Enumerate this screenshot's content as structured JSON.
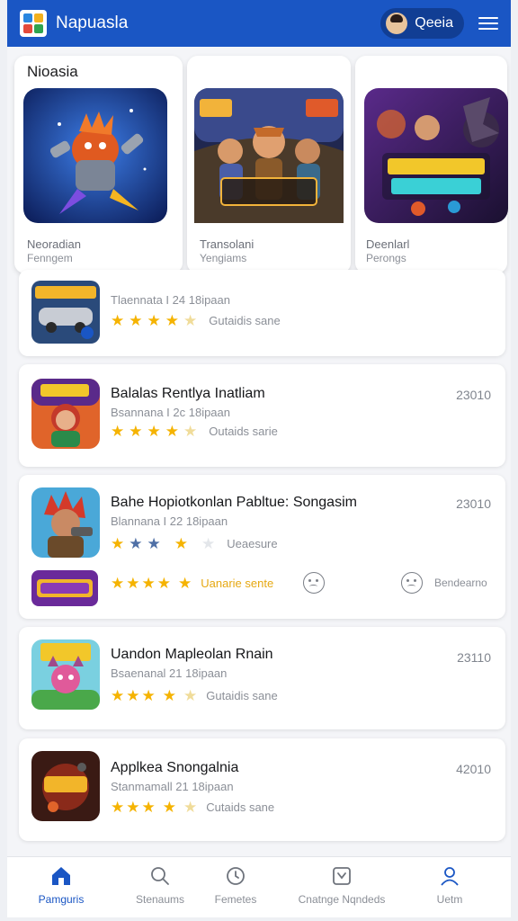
{
  "header": {
    "app_title": "Napuasla",
    "user_name": "Qeeia",
    "brand_color": "#1a56c4"
  },
  "featured": {
    "heading": "Nioasia",
    "items": [
      {
        "line1": "Neoradian",
        "line2": "Fenngem"
      },
      {
        "line1": "Transolani",
        "line2": "Yengiams"
      },
      {
        "line1": "Deenlarl",
        "line2": "Perongs"
      }
    ]
  },
  "list": [
    {
      "title": "",
      "subtitle": "Tlaennata I 24 18ipaan",
      "number": "",
      "rating_label": "Gutaidis sane",
      "stars": [
        "full",
        "full",
        "full",
        "full",
        "empty"
      ]
    },
    {
      "title": "Balalas Rentlya Inatliam",
      "subtitle": "Bsannana I 2c 18ipaan",
      "number": "23010",
      "rating_label": "Outaids sarie",
      "stars": [
        "full",
        "full",
        "full",
        "full",
        "empty"
      ]
    },
    {
      "title": "Bahe Hopiotkonlan Pabltue: Songasim",
      "subtitle": "Blannana I 22 18ipaan",
      "number": "23010",
      "rating_label": "Ueaesure",
      "stars": [
        "full",
        "blue",
        "blue",
        "full",
        "gray"
      ],
      "extra_rating_label": "Uanarie sente",
      "extra_stars": [
        "full",
        "full",
        "full",
        "full",
        "full"
      ],
      "extra_right_label": "Bendearno"
    },
    {
      "title": "Uandon Mapleolan Rnain",
      "subtitle": "Bsaenanal 21 18ipaan",
      "number": "23110",
      "rating_label": "Gutaidis sane",
      "stars": [
        "full",
        "full",
        "full",
        "full",
        "empty"
      ]
    },
    {
      "title": "Applkea Snongalnia",
      "subtitle": "Stanmamall 21 18ipaan",
      "number": "42010",
      "rating_label": "Cutaids sane",
      "stars": [
        "full",
        "full",
        "full",
        "full",
        "empty"
      ]
    }
  ],
  "bottom_nav": [
    {
      "label": "Pamguris",
      "icon": "home-icon",
      "active": true
    },
    {
      "label": "Stenaums",
      "icon": "search-icon",
      "active": false
    },
    {
      "label": "Femetes",
      "icon": "clock-icon",
      "active": false
    },
    {
      "label": "Cnatnge Nqndeds",
      "icon": "inbox-icon",
      "active": false
    },
    {
      "label": "Uetm",
      "icon": "user-icon",
      "active": false
    }
  ]
}
